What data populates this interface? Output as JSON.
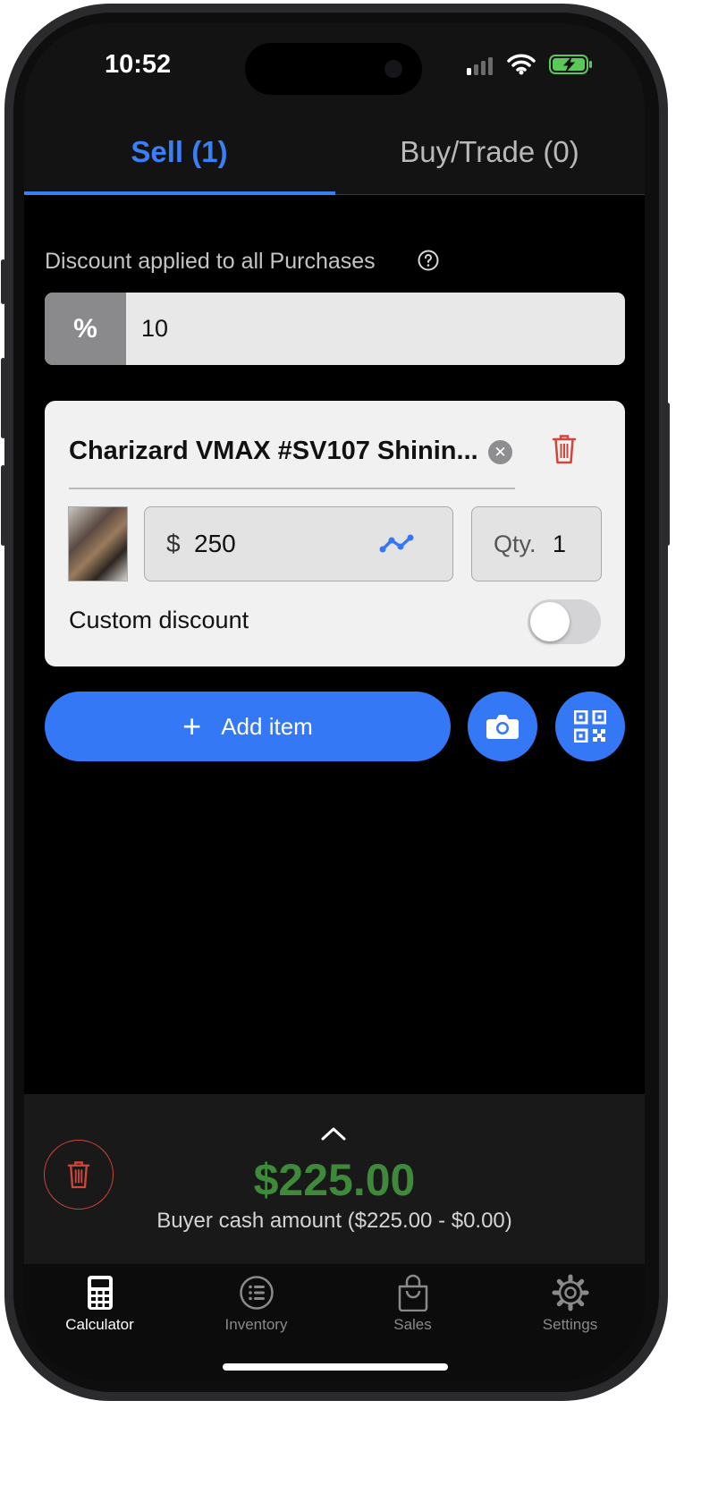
{
  "status_bar": {
    "time": "10:52"
  },
  "tabs": [
    {
      "label": "Sell (1)",
      "active": true
    },
    {
      "label": "Buy/Trade (0)",
      "active": false
    }
  ],
  "discount": {
    "label": "Discount applied to all Purchases",
    "unit": "%",
    "value": "10"
  },
  "item": {
    "title": "Charizard VMAX #SV107 Shinin...",
    "currency": "$",
    "price": "250",
    "qty_label": "Qty.",
    "qty": "1",
    "custom_discount_label": "Custom discount",
    "custom_discount_enabled": false
  },
  "actions": {
    "add_item_label": "Add item"
  },
  "summary": {
    "total": "$225.00",
    "buyer_line": "Buyer cash amount  ($225.00 - $0.00)"
  },
  "tabbar": [
    {
      "label": "Calculator",
      "active": true
    },
    {
      "label": "Inventory",
      "active": false
    },
    {
      "label": "Sales",
      "active": false
    },
    {
      "label": "Settings",
      "active": false
    }
  ],
  "colors": {
    "accent": "#3478f6",
    "total_green": "#3f8a3a",
    "danger": "#d0463b"
  }
}
